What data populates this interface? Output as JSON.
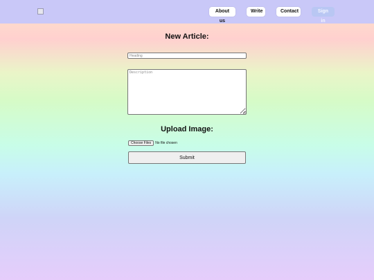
{
  "nav": {
    "logo_icon": "broken-image-icon",
    "about_label": "About us",
    "write_label": "Write",
    "contact_label": "Contact",
    "signin_label": "Sign in"
  },
  "form": {
    "title": "New Article:",
    "heading_placeholder": "Heading",
    "heading_value": "",
    "description_placeholder": "Description",
    "description_value": "",
    "upload_title": "Upload Image:",
    "file_button_label": "Choose Files",
    "file_status": "No file chosen",
    "submit_label": "Submit"
  },
  "colors": {
    "navbar": "#c9c8f8",
    "signin_button": "#b9c7f3"
  }
}
